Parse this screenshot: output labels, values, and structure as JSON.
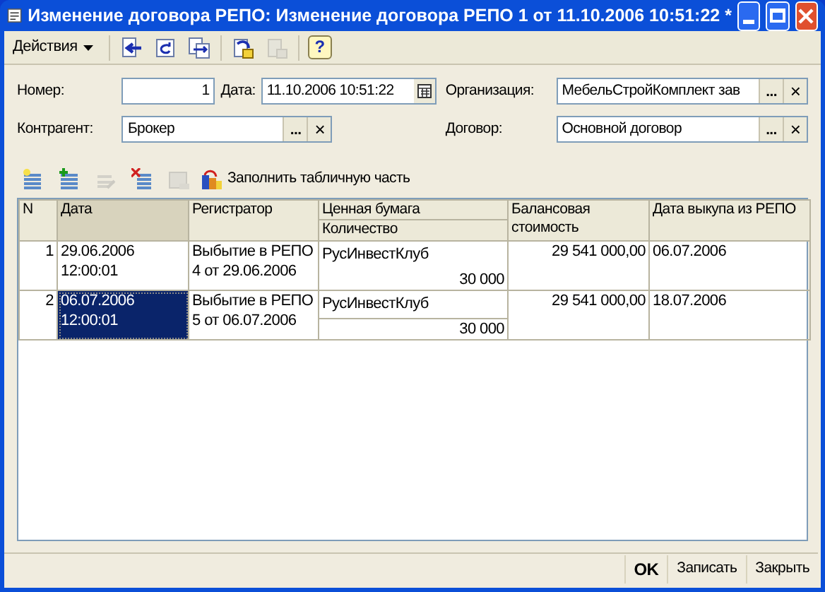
{
  "window": {
    "title": "Изменение договора РЕПО: Изменение договора РЕПО 1 от 11.10.2006 10:51:22 *"
  },
  "toolbar": {
    "menu": "Действия",
    "buttons": [
      {
        "kind": "back",
        "disabled": false
      },
      {
        "kind": "refresh",
        "disabled": false
      },
      {
        "kind": "copy",
        "disabled": false
      },
      {
        "kind": "post",
        "disabled": false
      },
      {
        "kind": "unpost",
        "disabled": true
      },
      {
        "kind": "help",
        "disabled": false,
        "label": "?"
      }
    ]
  },
  "form": {
    "number_label": "Номер:",
    "number": "1",
    "date_label": "Дата:",
    "date": "11.10.2006 10:51:22",
    "org_label": "Организация:",
    "org": "МебельСтройКомплект зав",
    "counterparty_label": "Контрагент:",
    "counterparty": "Брокер",
    "contract_label": "Договор:",
    "contract": "Основной договор",
    "select_button": "...",
    "clear_button": "×"
  },
  "table_toolbar": {
    "buttons": [
      {
        "kind": "add",
        "disabled": false
      },
      {
        "kind": "copy-row",
        "disabled": false
      },
      {
        "kind": "edit",
        "disabled": true
      },
      {
        "kind": "delete",
        "disabled": false
      },
      {
        "kind": "end-edit",
        "disabled": true
      }
    ],
    "fill_button": "Заполнить табличную часть"
  },
  "table": {
    "columns": [
      "N",
      "Дата",
      "Регистратор",
      "Ценная бумага",
      "Количество",
      "Балансовая стоимость",
      "Дата выкупа из РЕПО"
    ],
    "rows": [
      {
        "n": "1",
        "date": "29.06.2006 12:00:01",
        "registrar": "Выбытие в РЕПО 4 от 29.06.2006",
        "security": "РусИнвестКлуб",
        "quantity": "30 000",
        "balance": "29 541 000,00",
        "repo_date": "06.07.2006",
        "selected": false
      },
      {
        "n": "2",
        "date": "06.07.2006 12:00:01",
        "registrar": "Выбытие в РЕПО 5 от 06.07.2006",
        "security": "РусИнвестКлуб",
        "quantity": "30 000",
        "balance": "29 541 000,00",
        "repo_date": "18.07.2006",
        "selected": true
      }
    ]
  },
  "buttons": [
    {
      "label": "OK",
      "kind": "default"
    },
    {
      "label": "Записать",
      "kind": "normal"
    },
    {
      "label": "Закрыть",
      "kind": "normal"
    }
  ]
}
